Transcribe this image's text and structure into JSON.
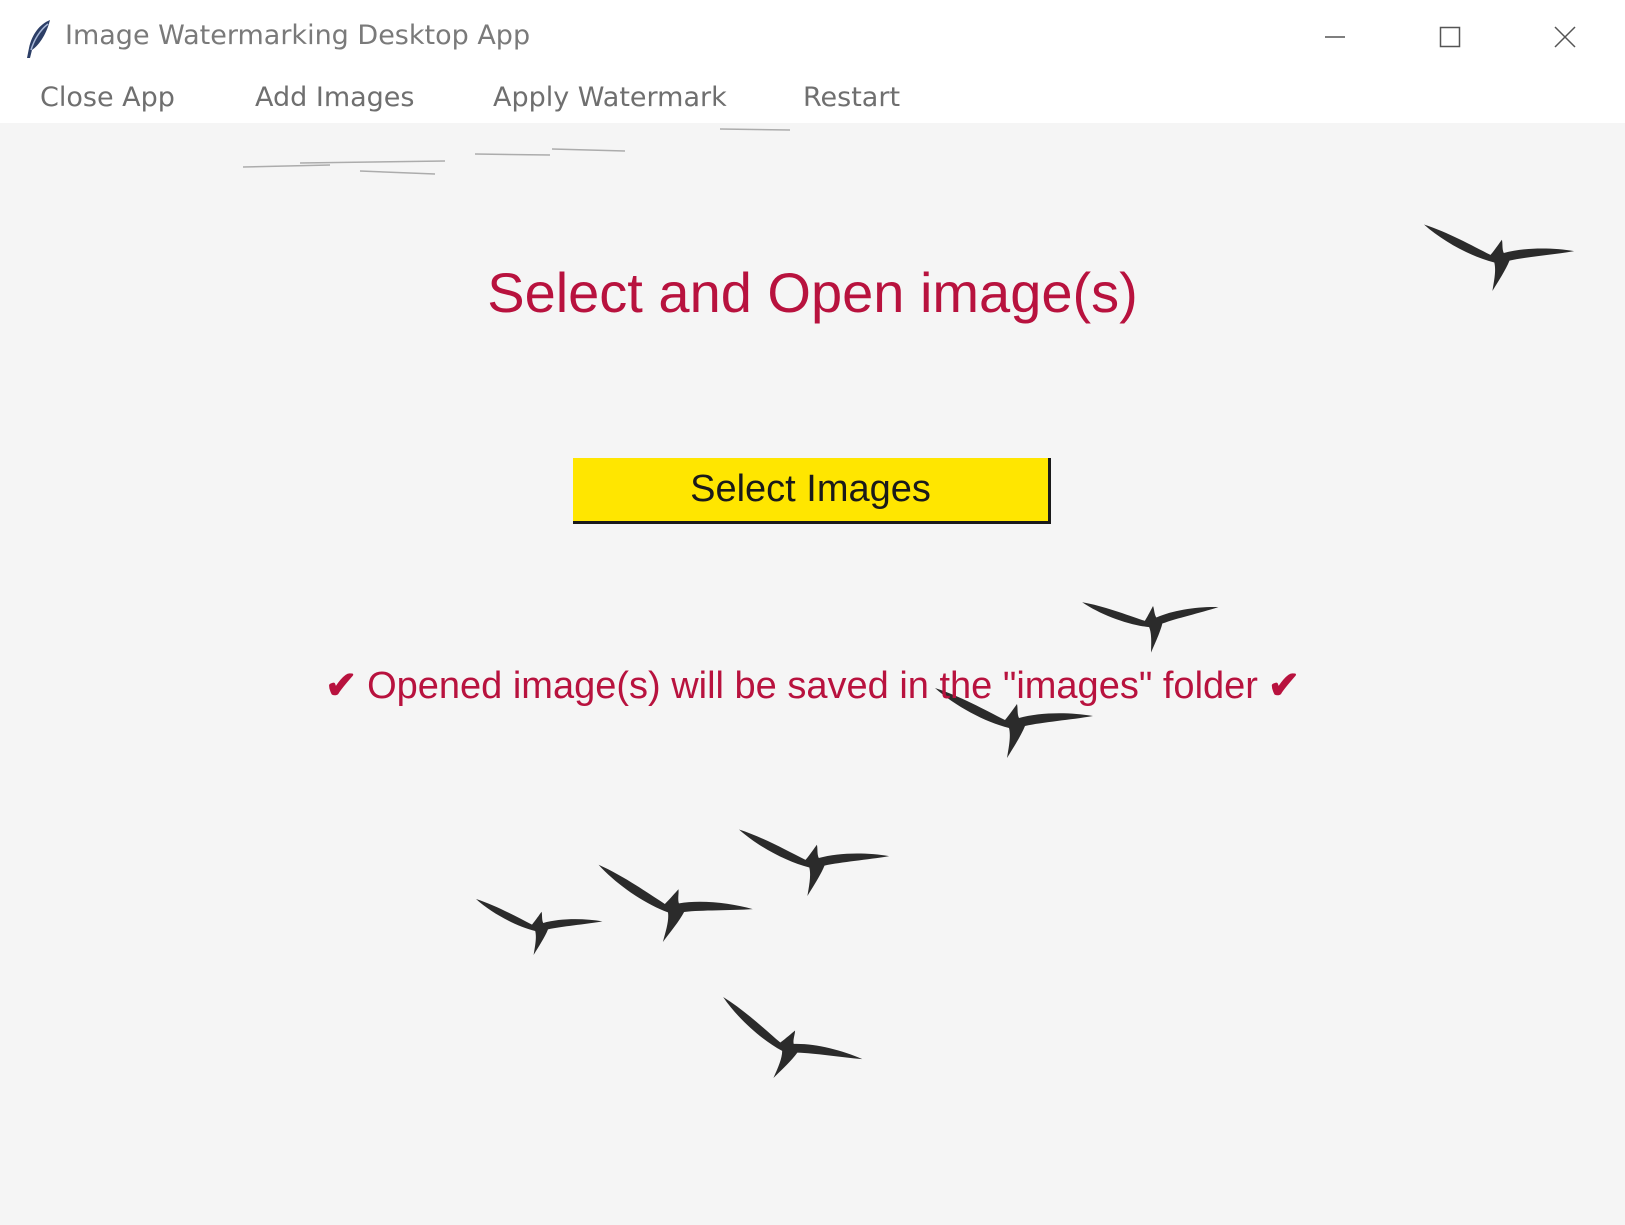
{
  "window": {
    "title": "Image Watermarking Desktop App",
    "icon": "feather-icon",
    "controls": [
      "minimize-icon",
      "maximize-icon",
      "close-icon"
    ]
  },
  "menu": {
    "items": [
      {
        "label": "Close App"
      },
      {
        "label": "Add Images"
      },
      {
        "label": "Apply Watermark"
      },
      {
        "label": "Restart"
      }
    ]
  },
  "main": {
    "heading": "Select and Open image(s)",
    "select_button_label": "Select Images",
    "info_check": "✔",
    "info_text": "Opened image(s) will be saved in the \"images\" folder",
    "background_image": "flying-birds-icon"
  },
  "colors": {
    "accent": "#b8123e",
    "button_bg": "#ffe600",
    "content_bg": "#f5f5f5"
  }
}
